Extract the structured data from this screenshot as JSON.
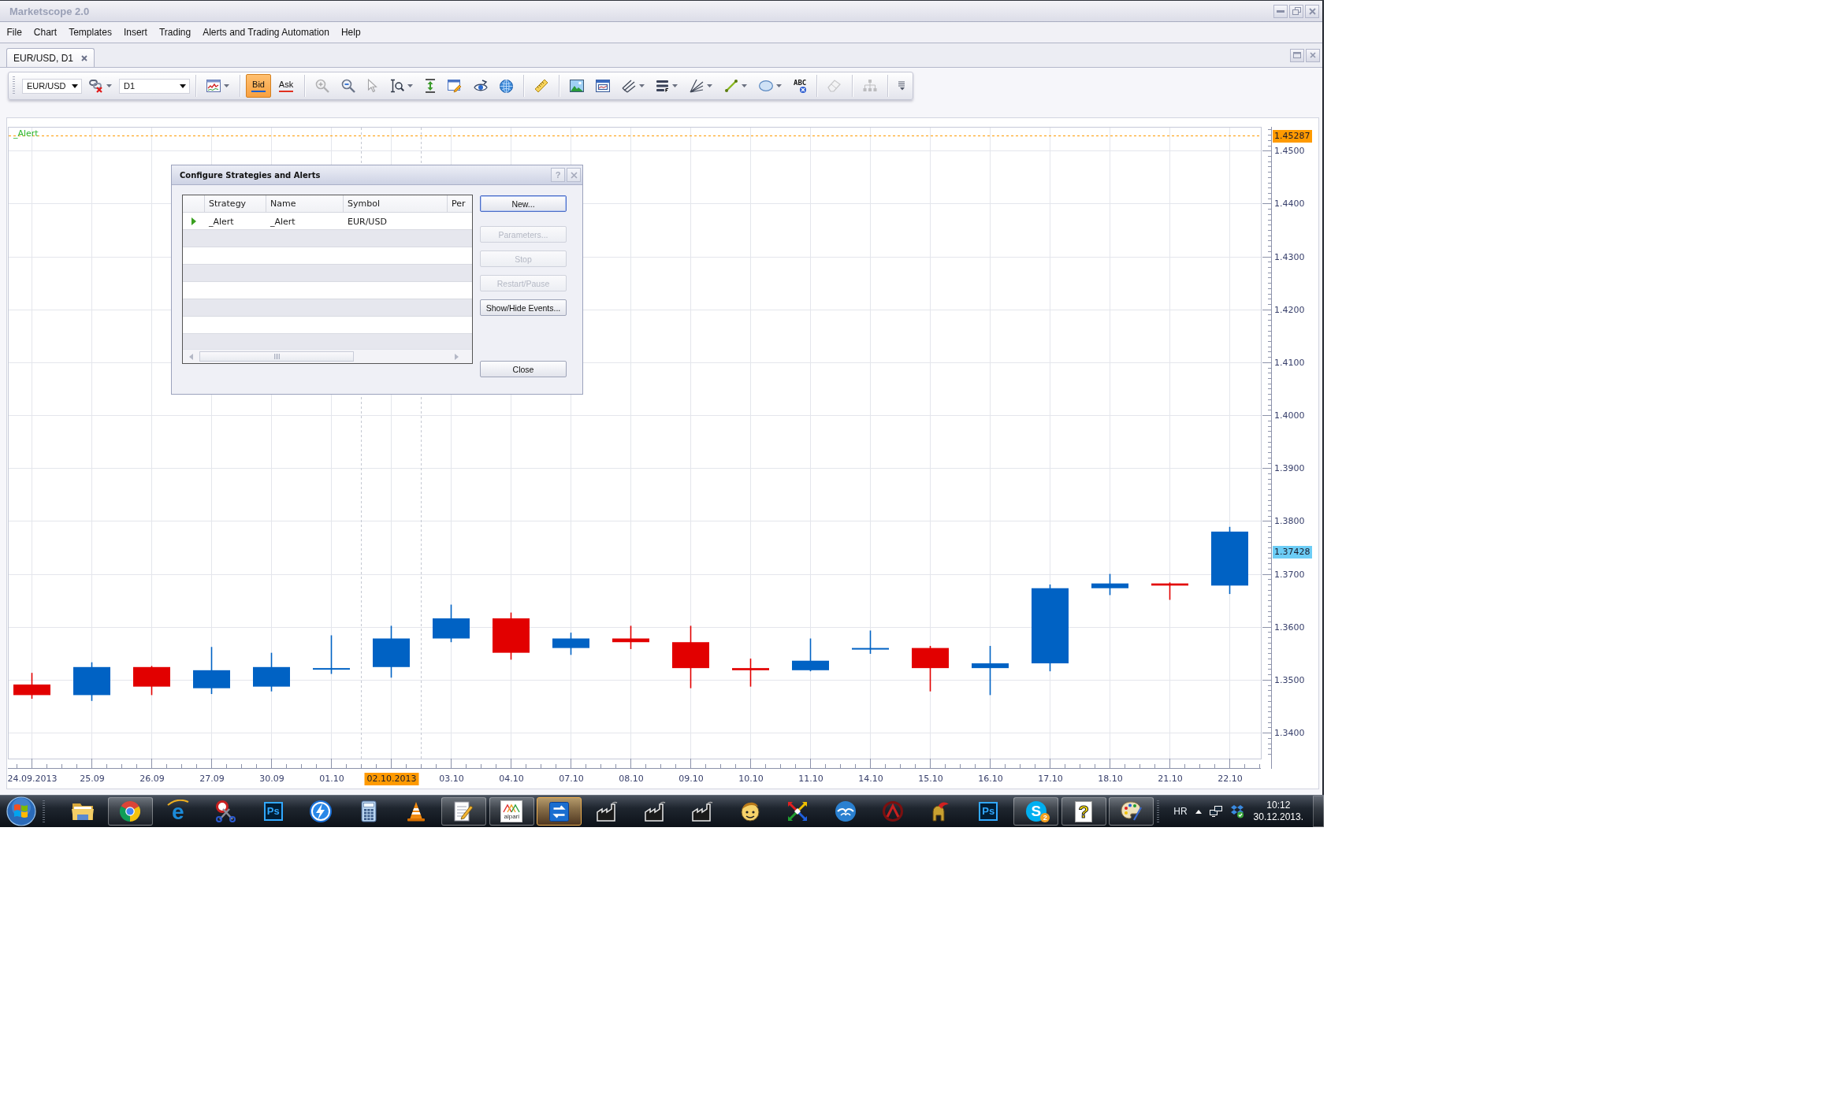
{
  "window": {
    "title": "Marketscope 2.0"
  },
  "menu": [
    "File",
    "Chart",
    "Templates",
    "Insert",
    "Trading",
    "Alerts and Trading Automation",
    "Help"
  ],
  "tabs": [
    {
      "label": "EUR/USD, D1",
      "selected": true
    }
  ],
  "toolbar": {
    "groups": [
      [
        {
          "kind": "symbol",
          "value": "EUR/USD"
        },
        {
          "kind": "link",
          "dropdown": true,
          "disabled": false
        },
        {
          "kind": "period",
          "value": "D1"
        }
      ],
      [
        {
          "kind": "charttype",
          "dropdown": true,
          "disabled": false
        }
      ],
      [
        {
          "kind": "toggle",
          "label": "Bid",
          "selected": true,
          "color": "#1a5fd0"
        },
        {
          "kind": "toggle",
          "label": "Ask",
          "selected": false,
          "color": "#e03020"
        }
      ],
      [
        {
          "kind": "zoomin",
          "dropdown": false,
          "disabled": true
        },
        {
          "kind": "zoomout",
          "dropdown": false,
          "disabled": false
        },
        {
          "kind": "pointer",
          "dropdown": false,
          "disabled": true
        },
        {
          "kind": "zoomrange",
          "dropdown": true,
          "disabled": false
        },
        {
          "kind": "autoscale",
          "dropdown": false,
          "disabled": false
        },
        {
          "kind": "properties",
          "dropdown": false,
          "disabled": false
        },
        {
          "kind": "eye",
          "dropdown": false,
          "disabled": false
        },
        {
          "kind": "globe",
          "dropdown": false,
          "disabled": false
        }
      ],
      [
        {
          "kind": "ruler",
          "dropdown": false,
          "disabled": false
        }
      ],
      [
        {
          "kind": "image",
          "dropdown": false,
          "disabled": false
        },
        {
          "kind": "window",
          "dropdown": false,
          "disabled": false
        },
        {
          "kind": "fork",
          "dropdown": true,
          "disabled": false
        },
        {
          "kind": "levels",
          "dropdown": true,
          "disabled": false
        },
        {
          "kind": "fan",
          "dropdown": true,
          "disabled": false
        },
        {
          "kind": "line",
          "dropdown": true,
          "disabled": false
        },
        {
          "kind": "ellipse",
          "dropdown": true,
          "disabled": false
        },
        {
          "kind": "text",
          "label": "ABC",
          "dropdown": false,
          "disabled": false
        }
      ],
      [
        {
          "kind": "eraser",
          "dropdown": false,
          "disabled": true
        }
      ],
      [
        {
          "kind": "tree",
          "dropdown": false,
          "disabled": true
        }
      ],
      [
        {
          "kind": "overflow",
          "dropdown": false,
          "disabled": false
        }
      ]
    ]
  },
  "chart": {
    "indicator_label": "_Alert",
    "price_tag": {
      "label": "1.37428",
      "color": "#6ccdf6"
    },
    "cursor": {
      "color": "#ff9a00",
      "at": [
        false,
        false,
        false,
        false,
        false,
        false,
        true,
        false,
        false,
        false,
        false,
        false,
        false,
        false,
        false,
        false,
        false,
        false,
        false,
        false,
        false
      ]
    },
    "chart_data": {
      "type": "candlestick",
      "categories": [
        "24.09.2013",
        "25.09",
        "26.09",
        "27.09",
        "30.09",
        "01.10",
        "02.10.2013",
        "03.10",
        "04.10",
        "07.10",
        "08.10",
        "09.10",
        "10.10",
        "11.10",
        "14.10",
        "15.10",
        "16.10",
        "17.10",
        "18.10",
        "21.10",
        "22.10"
      ],
      "ohlc": [
        [
          1.3491,
          1.3513,
          1.3464,
          1.3471
        ],
        [
          1.3471,
          1.3533,
          1.346,
          1.3524
        ],
        [
          1.3524,
          1.3526,
          1.3471,
          1.3487
        ],
        [
          1.3484,
          1.3562,
          1.3473,
          1.3518
        ],
        [
          1.3487,
          1.3551,
          1.3478,
          1.3524
        ],
        [
          1.352,
          1.3584,
          1.3511,
          1.3522
        ],
        [
          1.3524,
          1.3602,
          1.3504,
          1.3578
        ],
        [
          1.3578,
          1.3642,
          1.3571,
          1.3616
        ],
        [
          1.3616,
          1.3627,
          1.3538,
          1.3551
        ],
        [
          1.356,
          1.3589,
          1.3547,
          1.3578
        ],
        [
          1.3578,
          1.3602,
          1.3558,
          1.3571
        ],
        [
          1.3571,
          1.3602,
          1.3484,
          1.3522
        ],
        [
          1.3522,
          1.354,
          1.3487,
          1.3518
        ],
        [
          1.3518,
          1.3578,
          1.3516,
          1.3536
        ],
        [
          1.3558,
          1.3593,
          1.3549,
          1.356
        ],
        [
          1.356,
          1.3564,
          1.3478,
          1.3522
        ],
        [
          1.3522,
          1.3564,
          1.3471,
          1.3531
        ],
        [
          1.3531,
          1.368,
          1.3516,
          1.3673
        ],
        [
          1.3673,
          1.37,
          1.366,
          1.3682
        ],
        [
          1.3682,
          1.3684,
          1.3651,
          1.3678
        ],
        [
          1.3678,
          1.3789,
          1.3662,
          1.378
        ]
      ],
      "colors": [
        "#e20000",
        "#0062c4",
        "#e20000",
        "#0062c4",
        "#0062c4",
        "#0062c4",
        "#0062c4",
        "#0062c4",
        "#e20000",
        "#0062c4",
        "#e20000",
        "#e20000",
        "#e20000",
        "#0062c4",
        "#0062c4",
        "#e20000",
        "#0062c4",
        "#0062c4",
        "#0062c4",
        "#e20000",
        "#0062c4"
      ],
      "ylim": [
        1.3351,
        1.4545
      ],
      "yticks": [
        {
          "value": 1.45,
          "label": "1.4500"
        },
        {
          "value": 1.44,
          "label": "1.4400"
        },
        {
          "value": 1.43,
          "label": "1.4300"
        },
        {
          "value": 1.42,
          "label": "1.4200"
        },
        {
          "value": 1.41,
          "label": "1.4100"
        },
        {
          "value": 1.4,
          "label": "1.4000"
        },
        {
          "value": 1.39,
          "label": "1.3900"
        },
        {
          "value": 1.38,
          "label": "1.3800"
        },
        {
          "value": 1.37,
          "label": "1.3700"
        },
        {
          "value": 1.36,
          "label": "1.3600"
        },
        {
          "value": 1.35,
          "label": "1.3500"
        },
        {
          "value": 1.34,
          "label": "1.3400"
        }
      ],
      "ref_lines": [
        {
          "axis": "y",
          "value": 1.45287,
          "label": "1.45287",
          "color": "#ff9a00",
          "line_style": "dashed"
        }
      ],
      "grid": true
    }
  },
  "dialog": {
    "title": "Configure Strategies and Alerts",
    "help_button": "?",
    "table": {
      "columns": [
        "Strategy",
        "Name",
        "Symbol",
        "Per"
      ],
      "rows": [
        {
          "current": true,
          "cells": [
            "_Alert",
            "_Alert",
            "EUR/USD"
          ]
        }
      ]
    },
    "buttons": [
      {
        "label": "New...",
        "disabled": false,
        "default": true
      },
      {
        "label": "Parameters...",
        "disabled": true,
        "default": false
      },
      {
        "label": "Stop",
        "disabled": true,
        "default": false
      },
      {
        "label": "Restart/Pause",
        "disabled": true,
        "default": false
      },
      {
        "label": "Show/Hide Events...",
        "disabled": false,
        "default": false
      },
      {
        "label": "Close",
        "disabled": false,
        "default": false
      }
    ]
  },
  "taskbar": {
    "items": [
      {
        "kind": "folder",
        "open": false,
        "active": false
      },
      {
        "kind": "wheel",
        "open": true,
        "active": false
      },
      {
        "kind": "letter",
        "text": "e",
        "open": false,
        "active": false
      },
      {
        "kind": "scissors",
        "open": false,
        "active": false
      },
      {
        "kind": "tile",
        "text": "Ps",
        "open": false,
        "active": false
      },
      {
        "kind": "bolt",
        "open": false,
        "active": false
      },
      {
        "kind": "calculator",
        "open": false,
        "active": false
      },
      {
        "kind": "cone",
        "open": false,
        "active": false
      },
      {
        "kind": "notepad",
        "open": true,
        "active": false
      },
      {
        "kind": "stripes",
        "text": "alpari",
        "open": true,
        "active": false
      },
      {
        "kind": "swap",
        "open": true,
        "active": true
      },
      {
        "kind": "factory",
        "open": false,
        "active": false
      },
      {
        "kind": "factory",
        "open": false,
        "active": false
      },
      {
        "kind": "factory",
        "open": false,
        "active": false
      },
      {
        "kind": "face",
        "open": false,
        "active": false
      },
      {
        "kind": "arrows",
        "open": false,
        "active": false
      },
      {
        "kind": "birds",
        "open": false,
        "active": false
      },
      {
        "kind": "emblem",
        "open": false,
        "active": false
      },
      {
        "kind": "helmet",
        "open": false,
        "active": false
      },
      {
        "kind": "tile",
        "text": "Ps",
        "open": false,
        "active": false
      },
      {
        "kind": "bubble",
        "text": "S",
        "badge": "2",
        "open": true,
        "active": false
      },
      {
        "kind": "helpdoc",
        "text": "?",
        "open": true,
        "active": false
      },
      {
        "kind": "palette",
        "open": true,
        "active": false
      }
    ],
    "tray": {
      "language": "HR",
      "time": "10:12",
      "date": "30.12.2013."
    }
  }
}
